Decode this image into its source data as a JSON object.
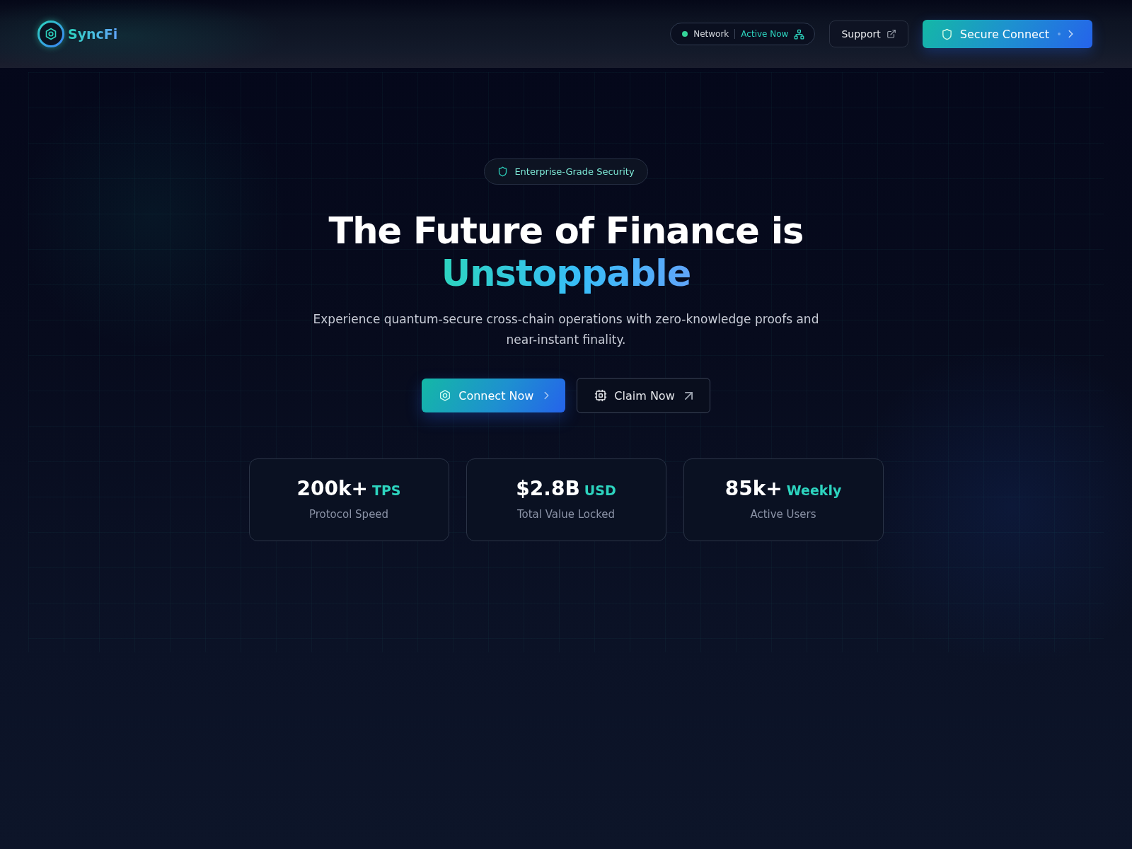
{
  "header": {
    "brand": {
      "name": "SyncFi"
    },
    "network_status": {
      "label": "Network",
      "status": "Active Now",
      "online": true
    },
    "support_button": {
      "label": "Support"
    },
    "connect_button": {
      "label": "Secure Connect"
    }
  },
  "hero": {
    "badge": "Enterprise-Grade Security",
    "title": "The Future of Finance is",
    "title_highlight": "Unstoppable",
    "subtitle": "Experience quantum-secure cross-chain operations with zero-knowledge proofs and near-instant finality.",
    "primary_action": {
      "label": "Connect Now"
    },
    "secondary_action": {
      "label": "Claim Now"
    },
    "stats": [
      {
        "value": "200k+",
        "unit": "TPS",
        "label": "Protocol Speed"
      },
      {
        "value": "$2.8B",
        "unit": "USD",
        "label": "Total Value Locked"
      },
      {
        "value": "85k+",
        "unit": "Weekly",
        "label": "Active Users"
      }
    ]
  }
}
